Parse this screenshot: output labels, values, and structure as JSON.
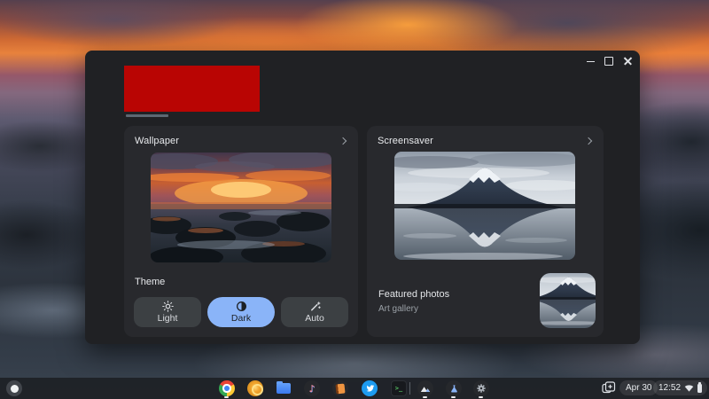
{
  "window": {
    "controls": [
      {
        "name": "minimize"
      },
      {
        "name": "maximize"
      },
      {
        "name": "close"
      }
    ],
    "redacted_banner_color": "#b90503"
  },
  "cards": {
    "wallpaper": {
      "title": "Wallpaper",
      "chevron_icon": "chevron-right-icon",
      "preview": "sunset-rocky-shore-photo"
    },
    "screensaver": {
      "title": "Screensaver",
      "chevron_icon": "chevron-right-icon",
      "preview": "mount-fuji-reflection-photo",
      "featured_title": "Featured photos",
      "featured_subtitle": "Art gallery",
      "thumbnail": "mount-fuji-reflection-thumbnail"
    }
  },
  "theme": {
    "label": "Theme",
    "options": [
      {
        "label": "Light",
        "icon": "sun-icon",
        "selected": false
      },
      {
        "label": "Dark",
        "icon": "contrast-half-circle-icon",
        "selected": true
      },
      {
        "label": "Auto",
        "icon": "magic-wand-icon",
        "selected": false
      }
    ],
    "selected_option": "Dark",
    "selected_bg_color": "#8ab4f8"
  },
  "shelf": {
    "launcher_icon": "launcher-circle-icon",
    "apps": [
      {
        "icon": "chrome-icon",
        "running": true
      },
      {
        "icon": "gold-circle-app-icon",
        "running": false
      },
      {
        "icon": "files-folder-icon",
        "running": false
      },
      {
        "icon": "music-note-app-icon",
        "running": false
      },
      {
        "icon": "notes-app-icon",
        "running": false
      },
      {
        "icon": "twitter-icon",
        "running": false
      },
      {
        "icon": "terminal-icon",
        "running": false
      },
      {
        "icon": "gallery-mountain-icon",
        "running": true
      },
      {
        "icon": "flask-app-icon",
        "running": true
      },
      {
        "icon": "settings-gear-icon",
        "running": true
      }
    ],
    "status": {
      "date": "Apr 30",
      "time": "12:52",
      "tray_icons": [
        "desks-switcher-icon",
        "wifi-icon",
        "battery-icon"
      ]
    }
  },
  "colors": {
    "window_bg": "#202124",
    "card_bg": "#28292d",
    "accent_blue": "#8ab4f8",
    "shelf_bg": "#1f2227"
  }
}
